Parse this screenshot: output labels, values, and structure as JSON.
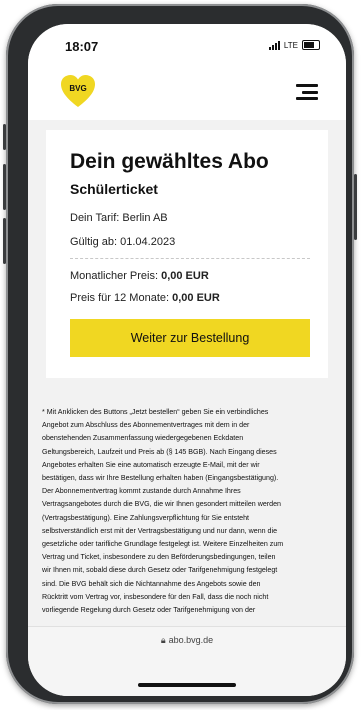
{
  "status": {
    "time": "18:07",
    "network": "LTE"
  },
  "header": {
    "logo_text": "BVG",
    "brand_color": "#f0d722",
    "menu_icon": "hamburger-menu-icon"
  },
  "card": {
    "title": "Dein gewähltes Abo",
    "subtitle": "Schülerticket",
    "tarif": "Dein Tarif: Berlin AB",
    "valid_from": "Gültig ab: 01.04.2023",
    "monthly_label": "Monatlicher Preis: ",
    "monthly_value": "0,00 EUR",
    "yearly_label": "Preis für 12 Monate: ",
    "yearly_value": "0,00 EUR",
    "cta_label": "Weiter zur Bestellung"
  },
  "legal": {
    "lines": [
      "* Mit Anklicken des Buttons „Jetzt bestellen“ geben Sie ein verbindliches",
      "Angebot zum Abschluss des Abonnementvertrages mit dem in der",
      "obenstehenden Zusammenfassung wiedergegebenen Eckdaten",
      "Geltungsbereich, Laufzeit und Preis ab (§ 145 BGB). Nach Eingang dieses",
      "Angebotes erhalten Sie eine automatisch erzeugte E-Mail, mit der wir",
      "bestätigen, dass wir Ihre Bestellung erhalten haben (Eingangsbestätigung).",
      "Der Abonnementvertrag kommt zustande durch Annahme Ihres",
      "Vertragsangebotes durch die BVG, die wir Ihnen gesondert mitteilen werden",
      "(Vertragsbestätigung). Eine Zahlungsverpflichtung für Sie entsteht",
      "selbstverständlich erst mit der Vertragsbestätigung und nur dann, wenn die",
      "gesetzliche oder tarifliche Grundlage festgelegt ist. Weitere Einzelheiten zum",
      "Vertrag und Ticket, insbesondere zu den Beförderungsbedingungen, teilen",
      "wir Ihnen mit, sobald diese durch Gesetz oder Tarifgenehmigung festgelegt",
      "sind. Die BVG behält sich die Nichtannahme des Angebots sowie den",
      "Rücktritt vom Vertrag vor, insbesondere für den Fall, dass die noch nicht",
      "vorliegende Regelung durch Gesetz oder Tarifgenehmigung von der"
    ]
  },
  "browser": {
    "url": "abo.bvg.de"
  }
}
